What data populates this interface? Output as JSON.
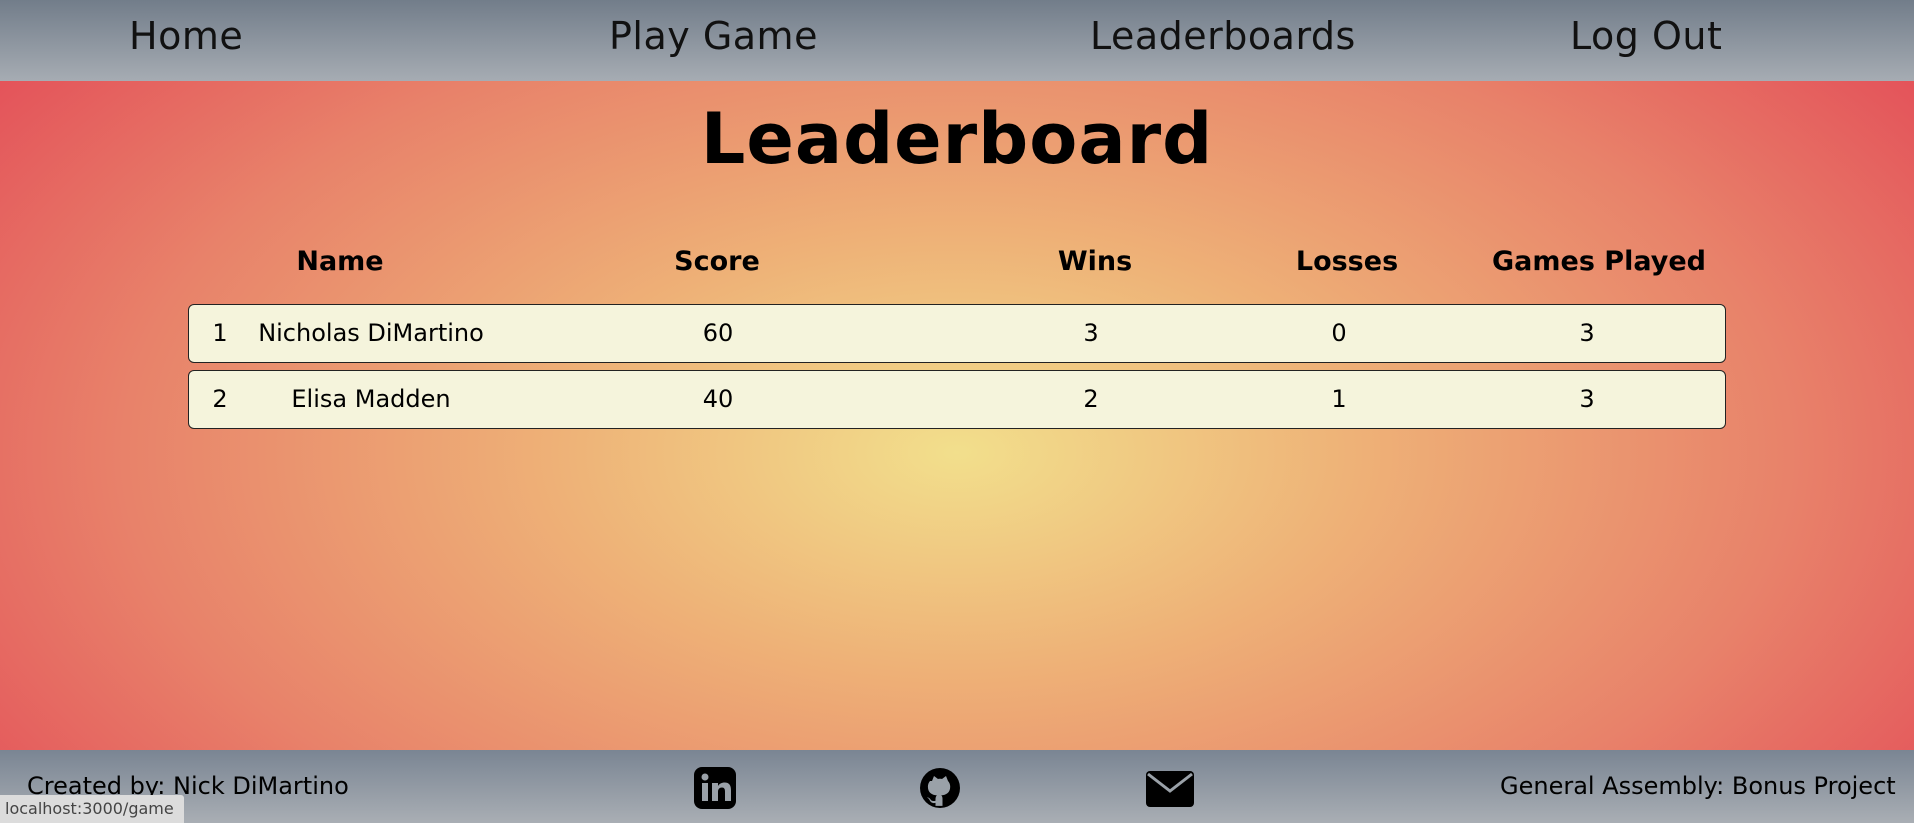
{
  "nav": {
    "home": "Home",
    "play": "Play Game",
    "leaderboards": "Leaderboards",
    "logout": "Log Out"
  },
  "page": {
    "title": "Leaderboard"
  },
  "table": {
    "headers": [
      "Name",
      "Score",
      "Wins",
      "Losses",
      "Games Played"
    ],
    "rows": [
      {
        "rank": "1",
        "name": "Nicholas DiMartino",
        "score": "60",
        "wins": "3",
        "losses": "0",
        "games": "3"
      },
      {
        "rank": "2",
        "name": "Elisa Madden",
        "score": "40",
        "wins": "2",
        "losses": "1",
        "games": "3"
      }
    ]
  },
  "footer": {
    "credit": "Created by: Nick DiMartino",
    "project": "General Assembly: Bonus Project",
    "icons": [
      "linkedin-icon",
      "github-icon",
      "email-icon"
    ]
  },
  "status_bar": {
    "url": "localhost:3000/game"
  },
  "colors": {
    "nav_bg": "#8e969f",
    "row_bg": "#f5f4dc",
    "gradient_center": "#f2df8c",
    "gradient_edge": "#e02c48"
  }
}
